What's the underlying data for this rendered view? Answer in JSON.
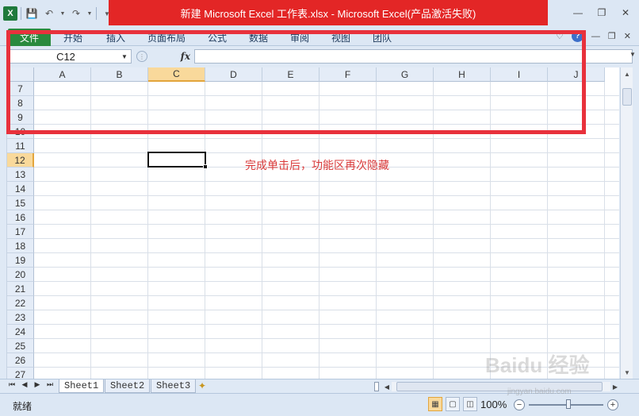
{
  "window": {
    "title": "新建 Microsoft Excel 工作表.xlsx  -  Microsoft Excel(产品激活失败)",
    "accent": "#e32626"
  },
  "ribbon": {
    "tabs": [
      "文件",
      "开始",
      "插入",
      "页面布局",
      "公式",
      "数据",
      "审阅",
      "视图",
      "团队"
    ]
  },
  "formula_bar": {
    "name_box": "C12",
    "fx_label": "fx",
    "formula": ""
  },
  "grid": {
    "columns": [
      "A",
      "B",
      "C",
      "D",
      "E",
      "F",
      "G",
      "H",
      "I",
      "J"
    ],
    "rows": [
      "7",
      "8",
      "9",
      "10",
      "11",
      "12",
      "13",
      "14",
      "15",
      "16",
      "17",
      "18",
      "19",
      "20",
      "21",
      "22",
      "23",
      "24",
      "25",
      "26",
      "27"
    ],
    "selected_column": "C",
    "selected_row": "12",
    "annotation": "完成单击后，功能区再次隐藏"
  },
  "sheets": [
    "Sheet1",
    "Sheet2",
    "Sheet3"
  ],
  "status": {
    "text": "就绪",
    "zoom": "100%"
  },
  "watermark": {
    "main": "Baidu 经验",
    "sub": "jingyan.baidu.com"
  }
}
